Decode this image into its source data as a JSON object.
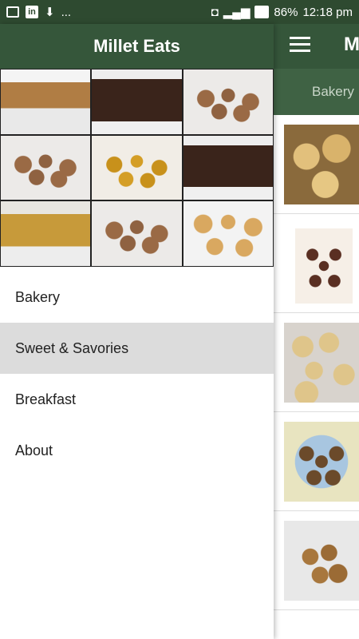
{
  "status_bar": {
    "battery": "86%",
    "time": "12:18 pm",
    "ellipsis": "...",
    "linkedin_icon_text": "in"
  },
  "app": {
    "title_partial": "M",
    "tab_partial": "Bakery",
    "list_items": [
      "ladoo-thumbnail",
      "choco-balls-thumbnail",
      "ladoo-plate-thumbnail",
      "dark-ladoo-thumbnail",
      "ladoo-bowl-thumbnail"
    ]
  },
  "drawer": {
    "title": "Millet Eats",
    "menu": [
      {
        "label": "Bakery",
        "active": false
      },
      {
        "label": "Sweet & Savories",
        "active": true
      },
      {
        "label": "Breakfast",
        "active": false
      },
      {
        "label": "About",
        "active": false
      }
    ]
  },
  "colors": {
    "primary": "#35563a",
    "status_bar": "#2e4a30",
    "active_item_bg": "#dcdcdc"
  }
}
